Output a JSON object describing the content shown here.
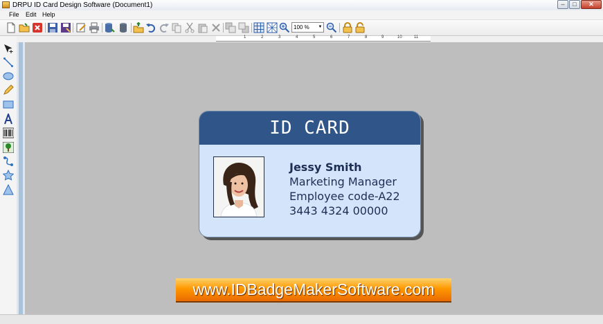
{
  "window": {
    "title": "DRPU ID Card Design Software  (Document1)",
    "min_glyph": "–",
    "max_glyph": "□",
    "close_glyph": "✕"
  },
  "menu": {
    "items": [
      "File",
      "Edit",
      "Help"
    ]
  },
  "toolbar": {
    "zoom_value": "100 %",
    "icons": [
      "new-icon",
      "open-icon",
      "close-doc-icon",
      "save-icon",
      "save-as-icon",
      "edit-icon",
      "print-icon",
      "database-icon",
      "stack-icon",
      "export-icon",
      "undo-icon",
      "redo-icon",
      "copy-icon",
      "cut-icon",
      "paste-icon",
      "delete-icon",
      "bring-front-icon",
      "send-back-icon",
      "grid-icon",
      "pattern-icon",
      "zoom-in-icon",
      "zoom-out-icon",
      "lock-icon",
      "unlock-icon"
    ]
  },
  "left_tools": [
    "select-icon",
    "line-icon",
    "ellipse-icon",
    "pencil-icon",
    "rectangle-icon",
    "text-icon",
    "barcode-icon",
    "image-icon",
    "curve-icon",
    "star-icon",
    "triangle-icon"
  ],
  "ruler": {
    "labels": [
      "1",
      "2",
      "3",
      "4",
      "5",
      "6",
      "7",
      "8",
      "9",
      "10",
      "11"
    ]
  },
  "card": {
    "title": "ID CARD",
    "name": "Jessy Smith",
    "position": "Marketing Manager",
    "code": "Employee code-A22",
    "phone": "3443  4324 00000"
  },
  "banner": {
    "text": "www.IDBadgeMakerSoftware.com"
  },
  "colors": {
    "card_header": "#2f5589",
    "card_body": "#d4e4fb",
    "banner": "#ff9800",
    "canvas": "#bebebe"
  }
}
